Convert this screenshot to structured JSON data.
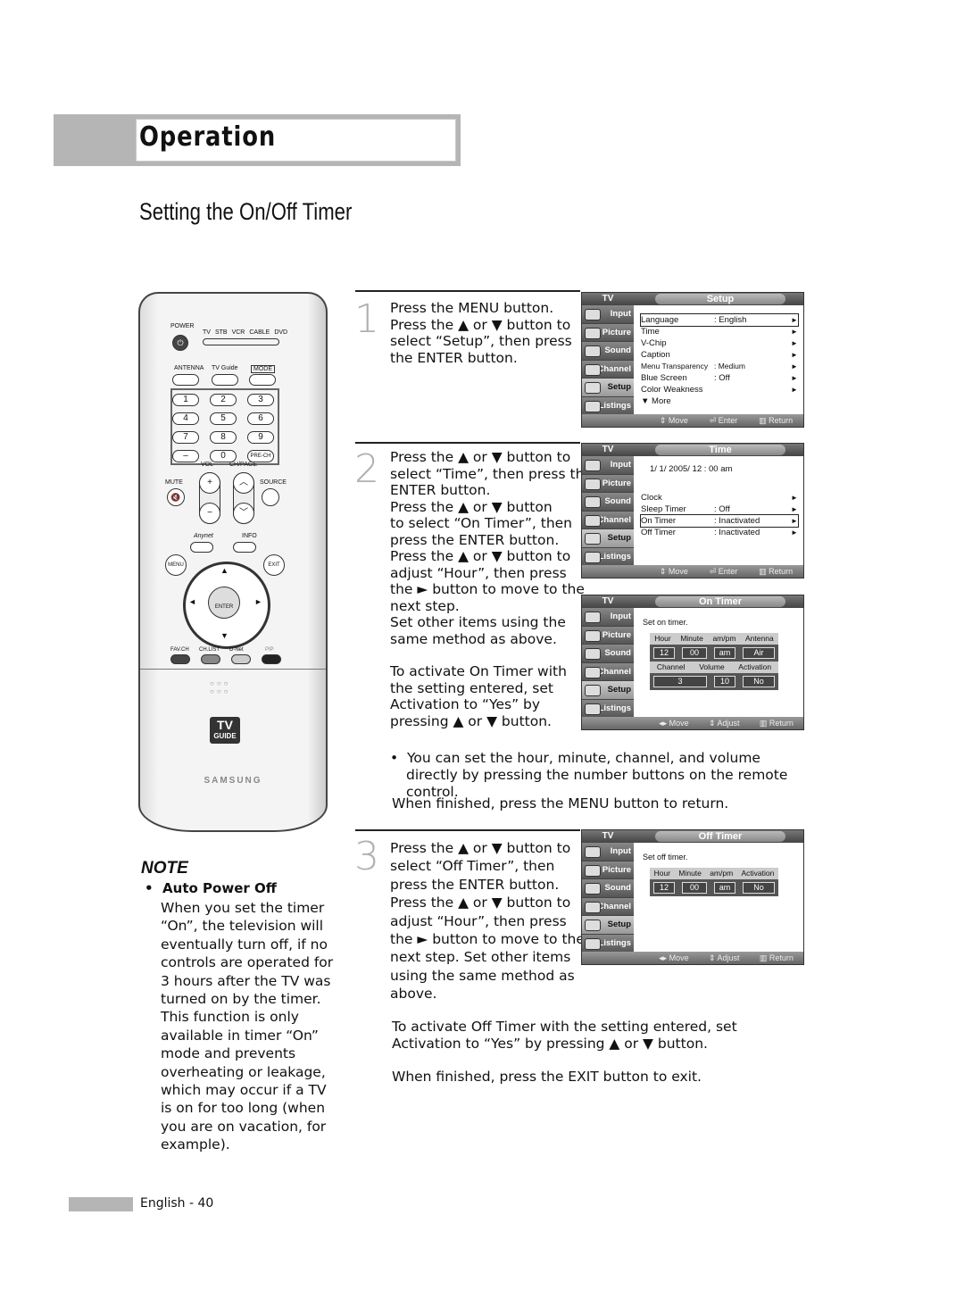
{
  "header": {
    "section": "Operation",
    "title": "Setting the On/Off Timer"
  },
  "remote": {
    "power_label": "POWER",
    "modes": [
      "TV",
      "STB",
      "VCR",
      "CABLE",
      "DVD"
    ],
    "top_buttons": [
      "ANTENNA",
      "TV Guide",
      "MODE"
    ],
    "numbers": [
      "1",
      "2",
      "3",
      "4",
      "5",
      "6",
      "7",
      "8",
      "9",
      "–",
      "0",
      "PRE-CH"
    ],
    "labels": {
      "vol": "VOL",
      "chpage": "CH/PAGE",
      "mute": "MUTE",
      "source": "SOURCE",
      "anynet": "Anynet",
      "info": "INFO",
      "menu": "MENU",
      "exit": "EXIT",
      "enter": "ENTER"
    },
    "bottom_buttons": [
      "FAV.CH",
      "CH.LIST",
      "D-Net",
      "PIP"
    ],
    "logo": "TV GUIDE",
    "brand": "SAMSUNG"
  },
  "steps": [
    {
      "number": "1",
      "text": [
        "Press the MENU button.",
        "Press the ▲ or ▼ button to",
        "select “Setup”, then press",
        "the ENTER button."
      ]
    },
    {
      "number": "2",
      "text": [
        "Press the ▲ or ▼ button to",
        "select “Time”, then press the",
        "ENTER button.",
        "Press the ▲ or ▼ button",
        "to select “On Timer”, then",
        "press the ENTER button.",
        "Press the ▲ or ▼ button to",
        "adjust “Hour”, then press",
        "the ► button to move to the",
        "next step.",
        "Set other items using the",
        "same method as above."
      ],
      "extra": [
        "To activate On Timer with",
        "the setting entered, set",
        "Activation to “Yes” by",
        "pressing ▲ or ▼ button."
      ],
      "bullet": "You can set the hour, minute, channel, and volume directly by pressing the number buttons on the remote control.",
      "after": "When finished, press the MENU button to return."
    },
    {
      "number": "3",
      "text": [
        "Press the ▲ or ▼ button to",
        "select “Off Timer”, then",
        "press the ENTER button.",
        "Press the ▲ or ▼ button to",
        "adjust “Hour”, then press",
        "the ► button to move to the",
        "next step. Set other items",
        "using the same method as",
        "above."
      ],
      "extra": "To activate Off Timer with the setting entered, set Activation to “Yes” by pressing ▲ or ▼ button.",
      "after": "When finished, press the EXIT button to exit."
    }
  ],
  "osd_common": {
    "tv_label": "TV",
    "sidebar": [
      "Input",
      "Picture",
      "Sound",
      "Channel",
      "Setup",
      "Listings"
    ]
  },
  "osd_setup": {
    "title": "Setup",
    "rows": [
      {
        "k": "Language",
        "v": ": English",
        "arrow": "►"
      },
      {
        "k": "Time",
        "v": "",
        "arrow": "►"
      },
      {
        "k": "V-Chip",
        "v": "",
        "arrow": "►"
      },
      {
        "k": "Caption",
        "v": "",
        "arrow": "►"
      },
      {
        "k": "Menu Transparency",
        "v": ": Medium",
        "arrow": "►"
      },
      {
        "k": "Blue Screen",
        "v": ": Off",
        "arrow": "►"
      },
      {
        "k": "Color Weakness",
        "v": "",
        "arrow": "►"
      },
      {
        "k": "▼ More",
        "v": "",
        "arrow": ""
      }
    ],
    "footer": [
      "⇕ Move",
      "⏎ Enter",
      "▥ Return"
    ]
  },
  "osd_time": {
    "title": "Time",
    "datetime": "1/  1/ 2005/ 12 : 00 am",
    "rows": [
      {
        "k": "Clock",
        "v": "",
        "arrow": "►"
      },
      {
        "k": "Sleep Timer",
        "v": ": Off",
        "arrow": "►"
      },
      {
        "k": "On Timer",
        "v": ": Inactivated",
        "arrow": "►"
      },
      {
        "k": "Off Timer",
        "v": ": Inactivated",
        "arrow": "►"
      }
    ],
    "footer": [
      "⇕ Move",
      "⏎ Enter",
      "▥ Return"
    ]
  },
  "osd_on": {
    "title": "On Timer",
    "subtitle": "Set on timer.",
    "head1": [
      "Hour",
      "Minute",
      "am/pm",
      "Antenna"
    ],
    "vals1": [
      "12",
      "00",
      "am",
      "Air"
    ],
    "head2": [
      "Channel",
      "Volume",
      "Activation"
    ],
    "vals2": [
      "3",
      "10",
      "No"
    ],
    "footer": [
      "◂▸ Move",
      "⇕ Adjust",
      "▥ Return"
    ]
  },
  "osd_off": {
    "title": "Off Timer",
    "subtitle": "Set off timer.",
    "head1": [
      "Hour",
      "Minute",
      "am/pm",
      "Activation"
    ],
    "vals1": [
      "12",
      "00",
      "am",
      "No"
    ],
    "footer": [
      "◂▸ Move",
      "⇕ Adjust",
      "▥ Return"
    ]
  },
  "note": {
    "heading": "NOTE",
    "bullet_title": "Auto Power Off",
    "text": [
      "When you set the timer",
      "“On”, the television will",
      "eventually turn off, if no",
      "controls are operated for",
      "3 hours after the TV was",
      "turned on by the timer.",
      "This function is only",
      "available in timer “On”",
      "mode and prevents",
      "overheating or leakage,",
      "which may occur if a TV",
      "is on for too long (when",
      "you are on vacation, for",
      "example)."
    ]
  },
  "footer": {
    "page": "English - 40"
  }
}
